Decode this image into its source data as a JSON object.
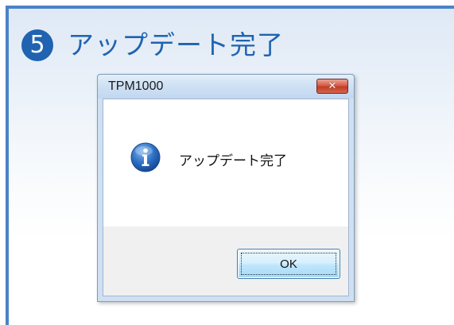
{
  "step": {
    "number": "5",
    "title": "アップデート完了"
  },
  "dialog": {
    "title": "TPM1000",
    "close_label": "✕",
    "message": "アップデート完了",
    "icon": "info-icon",
    "ok_label": "OK"
  },
  "colors": {
    "accent": "#1f63b1",
    "frame": "#4a83c6",
    "close_button": "#c13d26"
  }
}
